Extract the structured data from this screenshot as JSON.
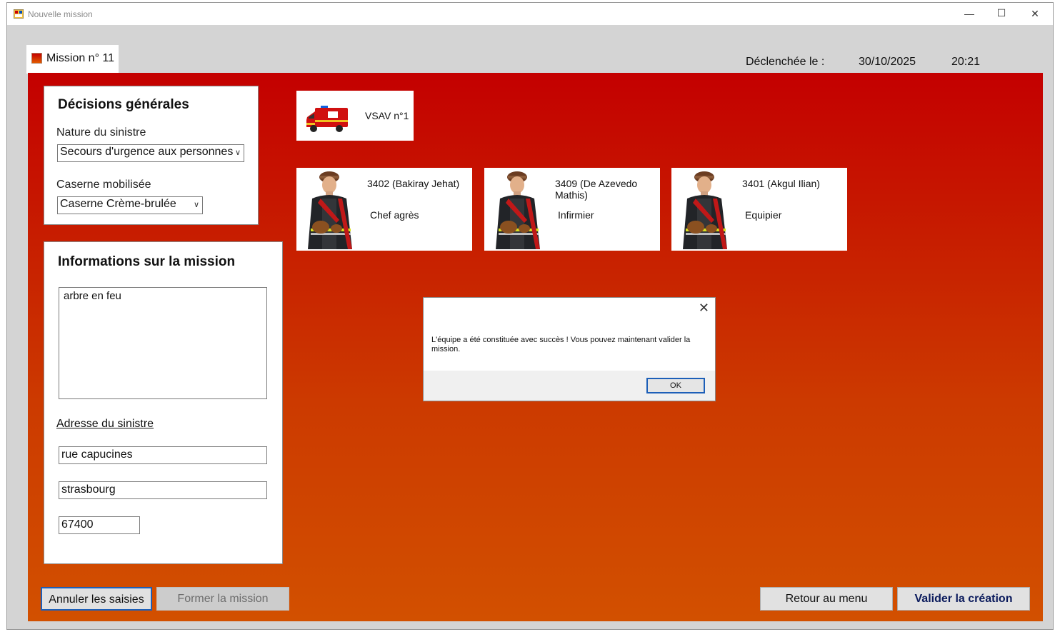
{
  "window": {
    "title": "Nouvelle mission",
    "minimize_label": "—",
    "maximize_label": "☐",
    "close_label": "✕"
  },
  "tab": {
    "label": "Mission n° 11"
  },
  "header": {
    "triggered_label": "Déclenchée le :",
    "date": "30/10/2025",
    "time": "20:21"
  },
  "decisions": {
    "title": "Décisions générales",
    "nature_label": "Nature du sinistre",
    "nature_value": "Secours d'urgence aux personnes",
    "caserne_label": "Caserne mobilisée",
    "caserne_value": "Caserne Crème-brulée"
  },
  "info": {
    "title": "Informations sur la mission",
    "description": "arbre en feu",
    "address_label": "Adresse du sinistre",
    "street": "rue capucines",
    "city": "strasbourg",
    "postal_code": "67400"
  },
  "vehicle": {
    "label": "VSAV n°1"
  },
  "crew": [
    {
      "name": "3402 (Bakiray Jehat)",
      "role": "Chef agrès"
    },
    {
      "name": "3409 (De Azevedo Mathis)",
      "role": "Infirmier"
    },
    {
      "name": "3401 (Akgul Ilian)",
      "role": "Equipier"
    }
  ],
  "dialog": {
    "close_label": "✕",
    "message": "L'équipe a été constituée avec succès ! Vous pouvez maintenant valider la mission.",
    "ok_label": "OK"
  },
  "buttons": {
    "cancel": "Annuler les saisies",
    "form": "Former la mission",
    "back": "Retour au menu",
    "validate": "Valider la création"
  },
  "colors": {
    "accent_top": "#c40000",
    "accent_bottom": "#d25000",
    "focus_blue": "#1d5fb8"
  }
}
